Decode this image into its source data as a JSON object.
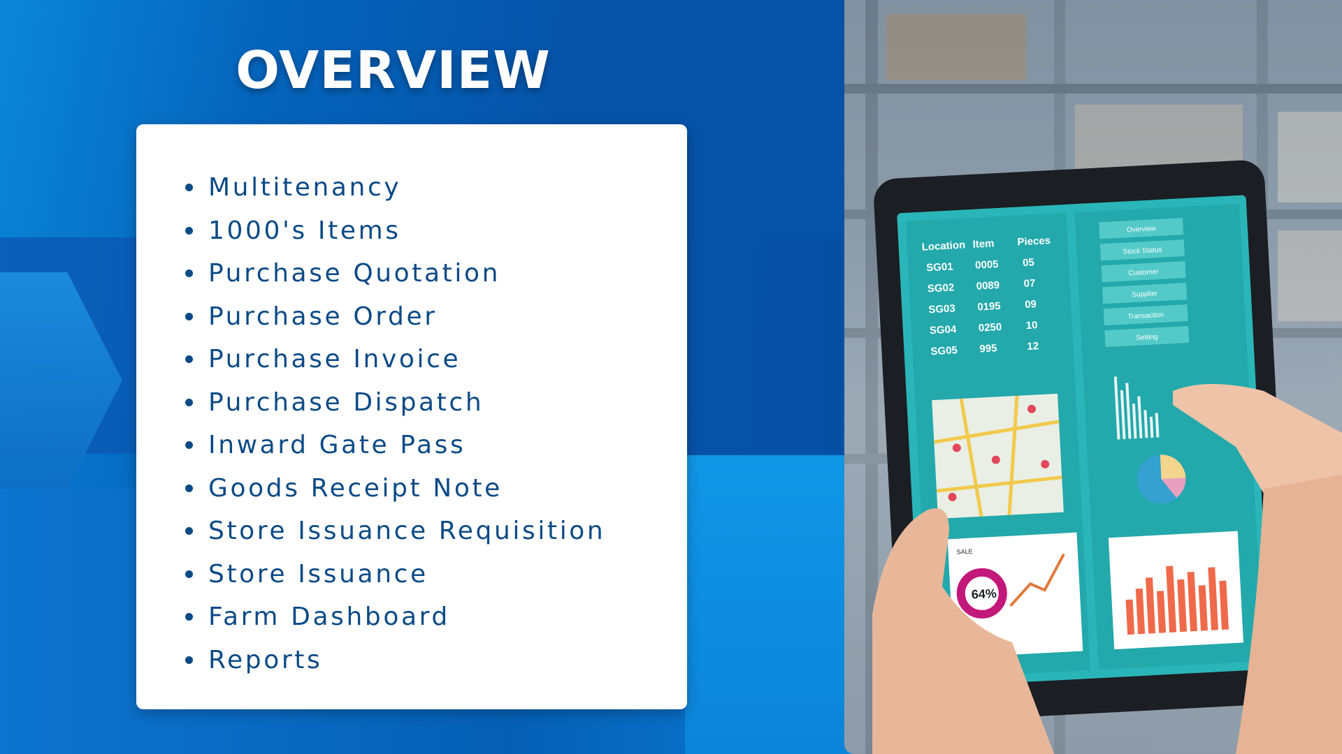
{
  "title": "OVERVIEW",
  "features": [
    "Multitenancy",
    "1000's Items",
    "Purchase Quotation",
    "Purchase Order",
    "Purchase Invoice",
    "Purchase Dispatch",
    "Inward Gate Pass",
    "Goods Receipt Note",
    "Store Issuance Requisition",
    "Store Issuance",
    "Farm Dashboard",
    "Reports"
  ],
  "photo": {
    "subject": "hands holding tablet in warehouse",
    "tablet_table": {
      "headers": [
        "Location",
        "Item",
        "Pieces"
      ],
      "rows": [
        [
          "SG01",
          "0005",
          "05"
        ],
        [
          "SG02",
          "0089",
          "07"
        ],
        [
          "SG03",
          "0195",
          "09"
        ],
        [
          "SG04",
          "0250",
          "10"
        ],
        [
          "SG05",
          "995",
          "12"
        ]
      ]
    },
    "tablet_menu": [
      "Overview",
      "Stock Status",
      "Customer",
      "Supplier",
      "Transaction",
      "Setting"
    ],
    "donut_value": "64%",
    "sale_tag": "SALE"
  },
  "colors": {
    "background": "#0553a8",
    "card_text": "#0c4a86",
    "tablet_screen": "#1aa3a8"
  }
}
